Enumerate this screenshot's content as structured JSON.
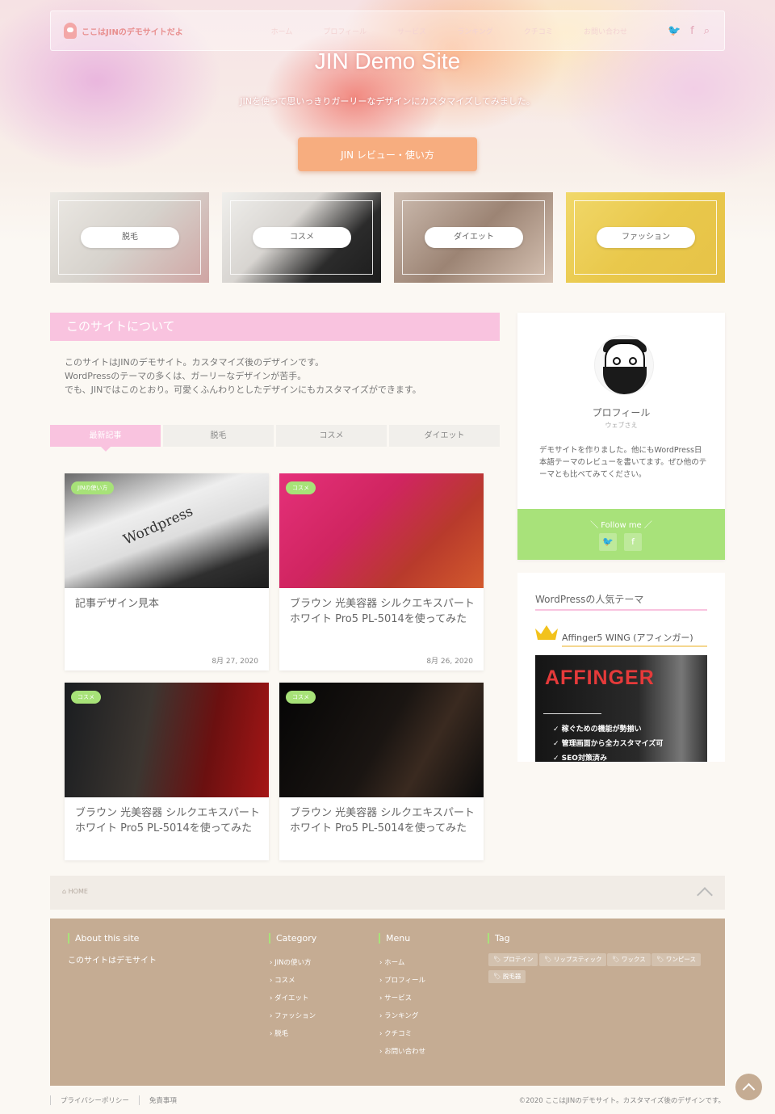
{
  "header": {
    "logo": "ここはJINのデモサイトだよ",
    "nav": [
      "ホーム",
      "プロフィール",
      "サービス",
      "ランキング",
      "クチコミ",
      "お問い合わせ"
    ],
    "icons": [
      "twitter-icon",
      "facebook-icon",
      "search-icon"
    ]
  },
  "hero": {
    "title": "JIN Demo Site",
    "subtitle": "JINを使って思いっきりガーリーなデザインにカスタマイズしてみました。",
    "button": "JIN レビュー・使い方"
  },
  "pickups": [
    {
      "label": "脱毛"
    },
    {
      "label": "コスメ"
    },
    {
      "label": "ダイエット"
    },
    {
      "label": "ファッション"
    }
  ],
  "about": {
    "heading": "このサイトについて",
    "lines": [
      "このサイトはJINのデモサイト。カスタマイズ後のデザインです。",
      "WordPressのテーマの多くは、ガーリーなデザインが苦手。",
      "でも、JINではこのとおり。可愛くふんわりとしたデザインにもカスタマイズができます。"
    ]
  },
  "tabs": [
    "最新記事",
    "脱毛",
    "コスメ",
    "ダイエット"
  ],
  "posts": [
    {
      "category": "JINの使い方",
      "title": "記事デザイン見本",
      "date": "8月 27, 2020",
      "thumb_text": "Wordpress"
    },
    {
      "category": "コスメ",
      "title": "ブラウン 光美容器 シルクエキスパート ホワイト Pro5 PL-5014を使ってみた",
      "date": "8月 26, 2020"
    },
    {
      "category": "コスメ",
      "title": "ブラウン 光美容器 シルクエキスパート ホワイト Pro5 PL-5014を使ってみた",
      "date": ""
    },
    {
      "category": "コスメ",
      "title": "ブラウン 光美容器 シルクエキスパート ホワイト Pro5 PL-5014を使ってみた",
      "date": ""
    }
  ],
  "profile": {
    "name": "プロフィール",
    "sub": "ウェブさえ",
    "desc": "デモサイトを作りました。他にもWordPress日本語テーマのレビューを書いてます。ぜひ他のテーマとも比べてみてください。",
    "follow_label": "＼ Follow me ／"
  },
  "widget": {
    "title": "WordPressの人気テーマ",
    "item": "Affinger5 WING (アフィンガー)",
    "banner_title": "AFFINGER",
    "banner_points": [
      "✓ 稼ぐための機能が勢揃い",
      "✓ 管理画面から全カスタマイズ可",
      "✓ SEO対策済み"
    ]
  },
  "breadcrumb": {
    "home": "HOME"
  },
  "footer": {
    "about_title": "About this site",
    "about_text": "このサイトはデモサイト",
    "category_title": "Category",
    "categories": [
      "JINの使い方",
      "コスメ",
      "ダイエット",
      "ファッション",
      "脱毛"
    ],
    "menu_title": "Menu",
    "menu": [
      "ホーム",
      "プロフィール",
      "サービス",
      "ランキング",
      "クチコミ",
      "お問い合わせ"
    ],
    "tag_title": "Tag",
    "tags": [
      "プロテイン",
      "リップスティック",
      "ワックス",
      "ワンピース",
      "脱毛器"
    ]
  },
  "bottom": {
    "links": [
      "プライバシーポリシー",
      "免責事項"
    ],
    "copyright": "©2020 ここはJINのデモサイト。カスタマイズ後のデザインです。"
  },
  "colors": {
    "accent_pink": "#f9c3df",
    "accent_green": "#a8e27a",
    "footer_bg": "#c5ac93",
    "hero_button": "#f7ad7f"
  }
}
